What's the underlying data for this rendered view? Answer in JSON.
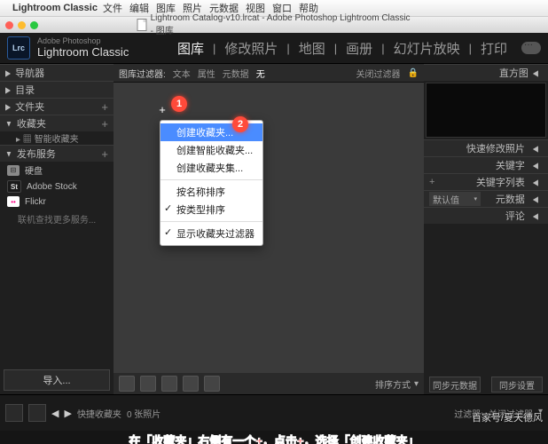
{
  "mac_menu": [
    "Lightroom Classic",
    "文件",
    "编辑",
    "图库",
    "照片",
    "元数据",
    "视图",
    "窗口",
    "帮助"
  ],
  "window_title": "Lightroom Catalog-v10.lrcat - Adobe Photoshop Lightroom Classic - 图库",
  "app": {
    "brand_small": "Adobe Photoshop",
    "brand_big": "Lightroom Classic",
    "badge": "Lrc"
  },
  "modules": {
    "lib": "图库",
    "dev": "修改照片",
    "map": "地图",
    "book": "画册",
    "slide": "幻灯片放映",
    "print": "打印"
  },
  "left": {
    "nav": "导航器",
    "catalog": "目录",
    "folders": "文件夹",
    "collections": "收藏夹",
    "smart": "智能收藏夹",
    "publish": "发布服务",
    "svc_hd": "硬盘",
    "svc_stock": "Adobe Stock",
    "svc_flickr": "Flickr",
    "more": "联机查找更多服务...",
    "import": "导入..."
  },
  "filter_bar": {
    "label": "图库过滤器:",
    "text": "文本",
    "attr": "属性",
    "meta": "元数据",
    "none": "无",
    "off": "关闭过滤器"
  },
  "context_menu": {
    "create": "创建收藏夹...",
    "create_smart": "创建智能收藏夹...",
    "create_set": "创建收藏夹集...",
    "by_name": "按名称排序",
    "by_type": "按类型排序",
    "show_filter": "显示收藏夹过滤器"
  },
  "markers": {
    "m1": "1",
    "m2": "2"
  },
  "right": {
    "hist": "直方图",
    "quick": "快速修改照片",
    "keyword": "关键字",
    "keyword_list": "关键字列表",
    "metadata": "元数据",
    "comments": "评论",
    "preset": "默认值",
    "sync": "同步元数据",
    "sync2": "同步设置"
  },
  "bottom_tb": {
    "sort": "排序方式"
  },
  "film": {
    "count": "0 张照片",
    "quick": "快捷收藏夹",
    "filter": "过滤器:",
    "off": "关闭过滤器"
  },
  "caption": "在「收藏夹」右侧有一个+，点击+，选择「创建收藏夹」",
  "byline": "百家号/夏天德风"
}
